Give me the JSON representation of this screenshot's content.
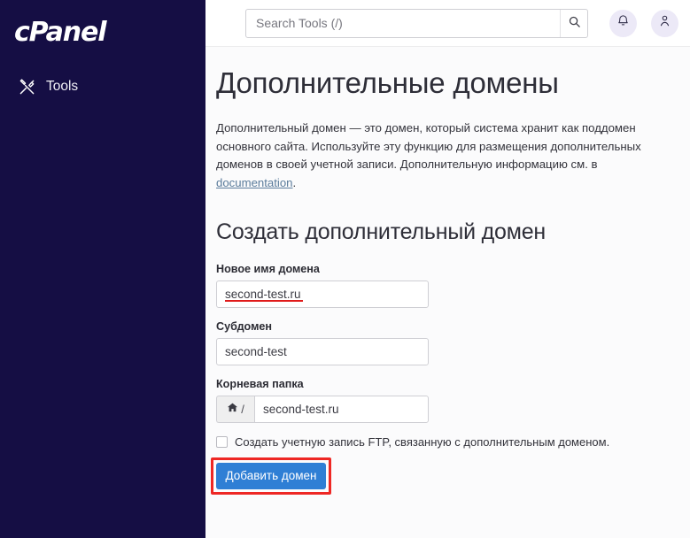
{
  "sidebar": {
    "brand": "cPanel",
    "items": [
      {
        "label": "Tools",
        "icon": "tools-icon"
      }
    ]
  },
  "topbar": {
    "search": {
      "placeholder": "Search Tools (/)",
      "value": "",
      "icon": "search-icon"
    },
    "actions": [
      {
        "name": "notifications-button",
        "icon": "bell-icon"
      },
      {
        "name": "user-account-button",
        "icon": "user-icon"
      }
    ]
  },
  "page": {
    "title": "Дополнительные домены",
    "description_before_link": "Дополнительный домен — это домен, который система хранит как поддомен основного сайта. Используйте эту функцию для размещения дополнительных доменов в своей учетной записи. Дополнительную информацию см. в ",
    "description_link": "documentation",
    "description_after_link": ".",
    "section_title": "Создать дополнительный домен"
  },
  "form": {
    "new_domain": {
      "label": "Новое имя домена",
      "value": "second-test.ru",
      "placeholder": "",
      "misspelled": true
    },
    "subdomain": {
      "label": "Субдомен",
      "value": "second-test",
      "placeholder": ""
    },
    "document_root": {
      "label": "Корневая папка",
      "prefix_icon": "home-icon",
      "prefix_separator": "/",
      "value": "second-test.ru",
      "placeholder": ""
    },
    "ftp_checkbox": {
      "label": "Создать учетную запись FTP, связанную с дополнительным доменом.",
      "checked": false
    },
    "submit": {
      "label": "Добавить домен"
    }
  },
  "colors": {
    "sidebar_bg": "#150e44",
    "submit_blue": "#2f7fd5",
    "annotation_red": "#ee2724",
    "misspell_red": "#e01b1b",
    "link_blue": "#5a7b9b",
    "icon_circle_bg": "#ece9f7"
  }
}
